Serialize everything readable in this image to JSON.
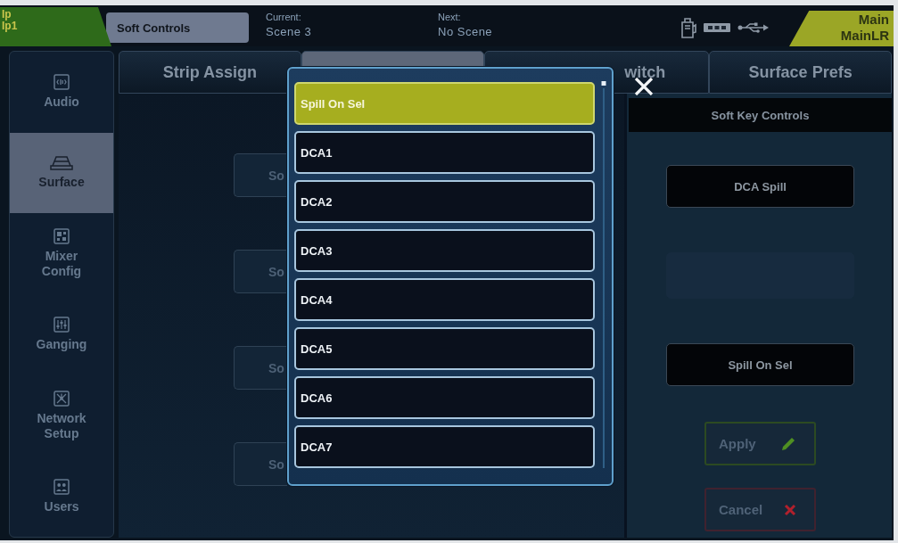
{
  "top_bar": {
    "input_badge": {
      "line_1": "Ip",
      "line_2": "Ip1"
    },
    "screen_title": "Soft Controls",
    "current": {
      "label": "Current:",
      "value": "Scene 3"
    },
    "next": {
      "label": "Next:",
      "value": "No Scene"
    },
    "output_badge": {
      "line_1": "Main",
      "line_2": "MainLR"
    }
  },
  "sidebar": {
    "items": [
      {
        "label": "Audio",
        "selected": false
      },
      {
        "label": "Surface",
        "selected": true
      },
      {
        "label": "Mixer Config",
        "selected": false
      },
      {
        "label": "Ganging",
        "selected": false
      },
      {
        "label": "Network Setup",
        "selected": false
      },
      {
        "label": "Users",
        "selected": false
      }
    ]
  },
  "tabs": [
    {
      "label": "Strip Assign",
      "selected": false
    },
    {
      "selected": true
    },
    {
      "label": "witch",
      "selected": false
    },
    {
      "label": "Surface Prefs",
      "selected": false
    }
  ],
  "soft_key_buttons": [
    "So",
    "So",
    "So",
    "So"
  ],
  "soft_key_controls": {
    "title": "Soft Key Controls",
    "keys": [
      {
        "kind": "assigned",
        "label": "DCA Spill"
      },
      {
        "kind": "empty"
      },
      {
        "kind": "assigned",
        "label": "Spill On Sel"
      }
    ],
    "actions": [
      {
        "kind": "apply",
        "label": "Apply"
      },
      {
        "kind": "cancel",
        "label": "Cancel"
      }
    ]
  },
  "dropdown": {
    "options": [
      {
        "label": "Spill On Sel",
        "selected": true
      },
      {
        "label": "DCA1",
        "selected": false
      },
      {
        "label": "DCA2",
        "selected": false
      },
      {
        "label": "DCA3",
        "selected": false
      },
      {
        "label": "DCA4",
        "selected": false
      },
      {
        "label": "DCA5",
        "selected": false
      },
      {
        "label": "DCA6",
        "selected": false
      },
      {
        "label": "DCA7",
        "selected": false
      }
    ]
  }
}
